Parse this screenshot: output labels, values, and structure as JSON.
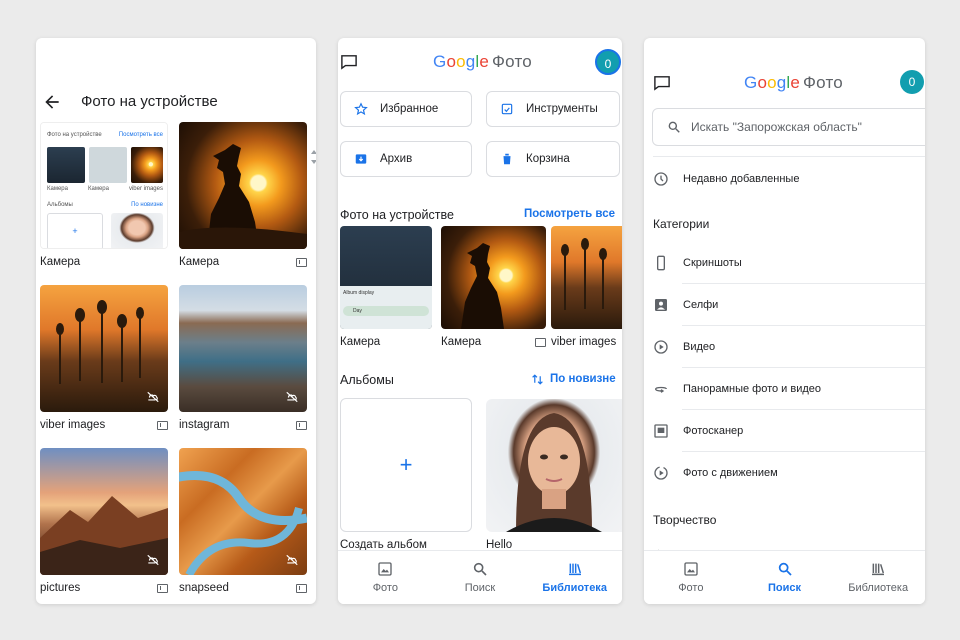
{
  "phone1": {
    "title": "Фото на устройстве",
    "mini": {
      "title": "Фото на устройстве",
      "link": "Посмотреть все",
      "captions": [
        "Камера",
        "Камера",
        "viber images"
      ],
      "albums": "Альбомы",
      "sort": "По новизне"
    },
    "tiles": [
      {
        "label": "Камера"
      },
      {
        "label": "Камера"
      },
      {
        "label": "viber images"
      },
      {
        "label": "instagram"
      },
      {
        "label": "pictures"
      },
      {
        "label": "snapseed"
      }
    ]
  },
  "phone2": {
    "logo": {
      "google": "Google",
      "foto": "Фото"
    },
    "avatar": "0",
    "buttons": [
      {
        "label": "Избранное",
        "icon": "star-icon"
      },
      {
        "label": "Инструменты",
        "icon": "tools-icon"
      },
      {
        "label": "Архив",
        "icon": "archive-icon"
      },
      {
        "label": "Корзина",
        "icon": "trash-icon"
      }
    ],
    "device_section": {
      "title": "Фото на устройстве",
      "link": "Посмотреть все"
    },
    "strip": [
      {
        "label": "Камера",
        "mini_text": "Album display",
        "mini_field": "Day"
      },
      {
        "label": "Камера"
      },
      {
        "label": "viber images"
      }
    ],
    "albums_section": {
      "title": "Альбомы",
      "sort": "По новизне"
    },
    "albums": [
      {
        "label": "Создать альбом"
      },
      {
        "label": "Hello"
      }
    ]
  },
  "phone3": {
    "logo": {
      "google": "Google",
      "foto": "Фото"
    },
    "avatar": "0",
    "search_placeholder": "Искать \"Запорожская область\"",
    "recent": "Недавно добавленные",
    "categories_title": "Категории",
    "categories": [
      {
        "label": "Скриншоты",
        "icon": "phone-icon"
      },
      {
        "label": "Селфи",
        "icon": "selfie-icon"
      },
      {
        "label": "Видео",
        "icon": "play-icon"
      },
      {
        "label": "Панорамные фото и видео",
        "icon": "panorama-icon"
      },
      {
        "label": "Фотосканер",
        "icon": "photoscan-icon"
      },
      {
        "label": "Фото с движением",
        "icon": "motion-icon"
      }
    ],
    "creativity_title": "Творчество"
  },
  "nav": {
    "photos": "Фото",
    "search": "Поиск",
    "library": "Библиотека"
  },
  "colors": {
    "accent": "#1a73e8",
    "avatar": "#129eaf"
  }
}
